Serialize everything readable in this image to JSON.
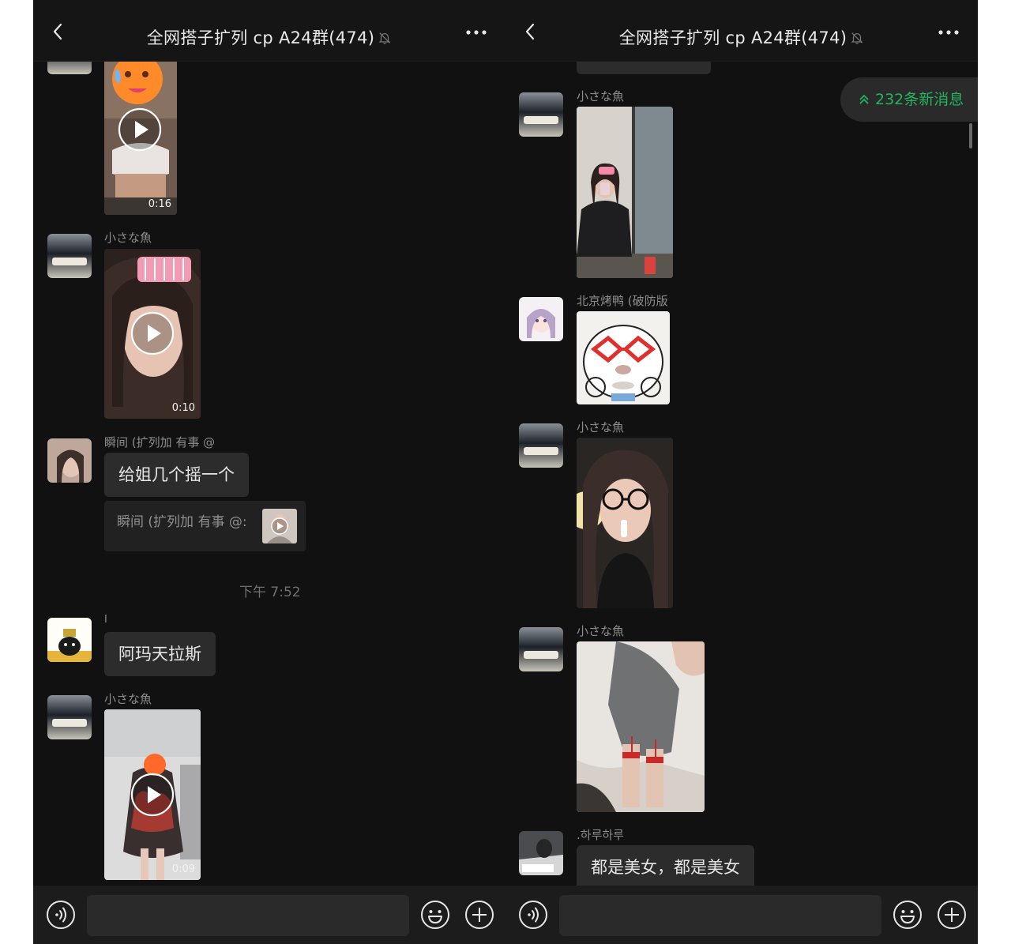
{
  "left": {
    "title": "全网搭子扩列 cp A24群(474)",
    "messages": {
      "video1_duration": "0:16",
      "sender2": "小さな魚",
      "video2_duration": "0:10",
      "sender3": "瞬间 (扩列加 有事 @",
      "text3": "给姐几个摇一个",
      "quote3": "瞬间 (扩列加 有事 @:",
      "timestamp": "下午 7:52",
      "sender4": "I",
      "text4": "阿玛天拉斯",
      "sender5": "小さな魚",
      "video5_duration": "0:09"
    },
    "input_placeholder": ""
  },
  "right": {
    "title": "全网搭子扩列 cp A24群(474)",
    "new_messages": "232条新消息",
    "messages": {
      "sender1": "小さな魚",
      "sender2": "北京烤鸭 (破防版",
      "sender3": "小さな魚",
      "sender4": "小さな魚",
      "sender5": ".하루하루",
      "text5": "都是美女，都是美女"
    },
    "input_placeholder": ""
  },
  "colors": {
    "panel_bg": "#111111",
    "topbar_bg": "#151515",
    "bubble_bg": "#2c2c2c",
    "accent_green": "#22b45e"
  }
}
